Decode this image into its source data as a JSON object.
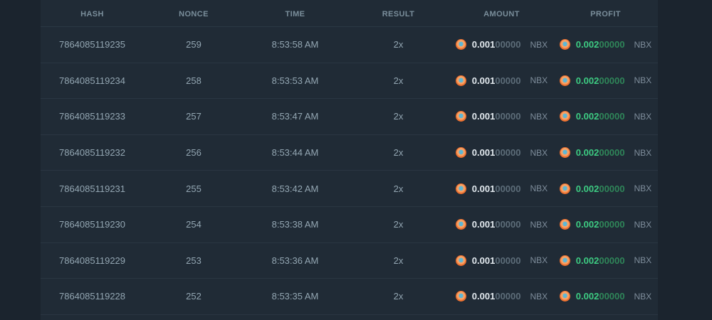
{
  "colors": {
    "page_background": "#1b242e",
    "panel_background": "#202b36",
    "divider": "#2a3642",
    "header_text": "#7a8e9b",
    "cell_text": "#93a6b2",
    "amount_text": "#e2e9ee",
    "faded_digits_gray": "#5d6d79",
    "profit_green": "#3dcb82",
    "profit_green_faded": "#2f8659",
    "currency_text": "#7e8d9b",
    "coin_orange": "#ee7130",
    "coin_center_blue": "#5fb7d4"
  },
  "icons": {
    "coin": "coin-icon"
  },
  "table": {
    "columns": [
      "HASH",
      "NONCE",
      "TIME",
      "RESULT",
      "AMOUNT",
      "PROFIT"
    ],
    "rows": [
      {
        "hash": "7864085119235",
        "nonce": "259",
        "time": "8:53:58 AM",
        "result": "2x",
        "amount": {
          "main": "0.001",
          "zeros": "00000",
          "currency": "NBX"
        },
        "profit": {
          "main": "0.002",
          "zeros": "00000",
          "currency": "NBX"
        }
      },
      {
        "hash": "7864085119234",
        "nonce": "258",
        "time": "8:53:53 AM",
        "result": "2x",
        "amount": {
          "main": "0.001",
          "zeros": "00000",
          "currency": "NBX"
        },
        "profit": {
          "main": "0.002",
          "zeros": "00000",
          "currency": "NBX"
        }
      },
      {
        "hash": "7864085119233",
        "nonce": "257",
        "time": "8:53:47 AM",
        "result": "2x",
        "amount": {
          "main": "0.001",
          "zeros": "00000",
          "currency": "NBX"
        },
        "profit": {
          "main": "0.002",
          "zeros": "00000",
          "currency": "NBX"
        }
      },
      {
        "hash": "7864085119232",
        "nonce": "256",
        "time": "8:53:44 AM",
        "result": "2x",
        "amount": {
          "main": "0.001",
          "zeros": "00000",
          "currency": "NBX"
        },
        "profit": {
          "main": "0.002",
          "zeros": "00000",
          "currency": "NBX"
        }
      },
      {
        "hash": "7864085119231",
        "nonce": "255",
        "time": "8:53:42 AM",
        "result": "2x",
        "amount": {
          "main": "0.001",
          "zeros": "00000",
          "currency": "NBX"
        },
        "profit": {
          "main": "0.002",
          "zeros": "00000",
          "currency": "NBX"
        }
      },
      {
        "hash": "7864085119230",
        "nonce": "254",
        "time": "8:53:38 AM",
        "result": "2x",
        "amount": {
          "main": "0.001",
          "zeros": "00000",
          "currency": "NBX"
        },
        "profit": {
          "main": "0.002",
          "zeros": "00000",
          "currency": "NBX"
        }
      },
      {
        "hash": "7864085119229",
        "nonce": "253",
        "time": "8:53:36 AM",
        "result": "2x",
        "amount": {
          "main": "0.001",
          "zeros": "00000",
          "currency": "NBX"
        },
        "profit": {
          "main": "0.002",
          "zeros": "00000",
          "currency": "NBX"
        }
      },
      {
        "hash": "7864085119228",
        "nonce": "252",
        "time": "8:53:35 AM",
        "result": "2x",
        "amount": {
          "main": "0.001",
          "zeros": "00000",
          "currency": "NBX"
        },
        "profit": {
          "main": "0.002",
          "zeros": "00000",
          "currency": "NBX"
        }
      }
    ]
  }
}
